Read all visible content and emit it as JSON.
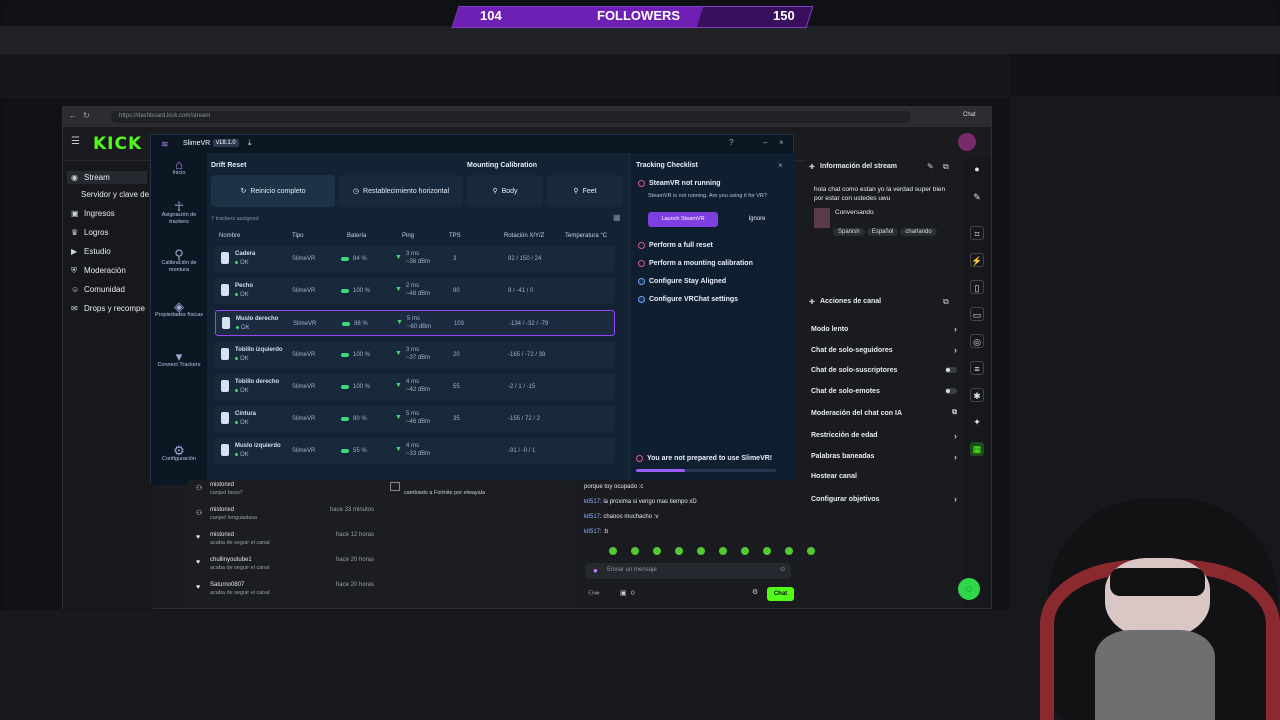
{
  "followers": {
    "current": "104",
    "label": "FOLLOWERS",
    "goal": "150",
    "progress": 0.69
  },
  "browser": {
    "url": "https://dashboard.kick.com/stream",
    "chat_ext": "Chat"
  },
  "kick": {
    "logo": "KICK"
  },
  "nav": {
    "items": [
      {
        "label": "Stream",
        "icon": "stream-icon"
      },
      {
        "label": "Servidor y clave de",
        "icon": ""
      },
      {
        "label": "Ingresos",
        "icon": "money-icon"
      },
      {
        "label": "Logros",
        "icon": "trophy-icon"
      },
      {
        "label": "Estudio",
        "icon": "studio-icon"
      },
      {
        "label": "Moderación",
        "icon": "shield-icon"
      },
      {
        "label": "Comunidad",
        "icon": "users-icon"
      },
      {
        "label": "Drops y recompe",
        "icon": "gift-icon"
      }
    ]
  },
  "slimevr": {
    "app_name": "SlimeVR",
    "version": "v18.1.0",
    "sidebar": [
      {
        "label": "Inicio",
        "icon": "home-icon"
      },
      {
        "label": "Asignación de trackers",
        "icon": "body-icon"
      },
      {
        "label": "Calibración de montura",
        "icon": "calibrate-icon"
      },
      {
        "label": "Propiedades físicas",
        "icon": "ruler-icon"
      },
      {
        "label": "Connect Trackers",
        "icon": "connect-icon"
      },
      {
        "label": "Configuración",
        "icon": "gear-icon"
      }
    ],
    "drift_reset": "Drift Reset",
    "mounting_calibration": "Mounting Calibration",
    "reset_full": "Reinicio completo",
    "reset_horizontal": "Restablecimiento horizontal",
    "body": "Body",
    "feet": "Feet",
    "assigned": "7 trackers assigned",
    "columns": [
      "Nombre",
      "Tipo",
      "Batería",
      "Ping",
      "TPS",
      "Rotación X/Y/Z",
      "Temperatura °C"
    ],
    "trackers": [
      {
        "name": "Cadera",
        "status": "OK",
        "type": "SlimeVR",
        "battery": "84 %",
        "ping": "3 ms",
        "ping2": "~36 dBm",
        "tps": "3",
        "rotation": "82 / 150 / 24"
      },
      {
        "name": "Pecho",
        "status": "OK",
        "type": "SlimeVR",
        "battery": "100 %",
        "ping": "2 ms",
        "ping2": "~48 dBm",
        "tps": "80",
        "rotation": "9 / -41 / 0"
      },
      {
        "name": "Muslo derecho",
        "status": "OK",
        "type": "SlimeVR",
        "battery": "88 %",
        "ping": "5 ms",
        "ping2": "~60 dBm",
        "tps": "103",
        "rotation": "-134 / -32 / -79"
      },
      {
        "name": "Tobillo izquierdo",
        "status": "OK",
        "type": "SlimeVR",
        "battery": "100 %",
        "ping": "3 ms",
        "ping2": "~37 dBm",
        "tps": "20",
        "rotation": "-165 / -72 / 39"
      },
      {
        "name": "Tobillo derecho",
        "status": "OK",
        "type": "SlimeVR",
        "battery": "100 %",
        "ping": "4 ms",
        "ping2": "~42 dBm",
        "tps": "55",
        "rotation": "-2 / 1 / -15"
      },
      {
        "name": "Cintura",
        "status": "OK",
        "type": "SlimeVR",
        "battery": "80 %",
        "ping": "5 ms",
        "ping2": "~46 dBm",
        "tps": "35",
        "rotation": "-155 / 72 / 2"
      },
      {
        "name": "Muslo izquierdo",
        "status": "OK",
        "type": "SlimeVR",
        "battery": "55 %",
        "ping": "4 ms",
        "ping2": "~33 dBm",
        "tps": "",
        "rotation": "-91 / -0 / 1"
      }
    ],
    "checklist": {
      "title": "Tracking Checklist",
      "steamvr_title": "SteamVR not running",
      "steamvr_desc": "SteamVR is not running. Are you using it for VR?",
      "launch": "Launch SteamVR",
      "ignore": "Ignore",
      "steps": [
        "Perform a full reset",
        "Perform a mounting calibration",
        "Configure Stay Aligned",
        "Configure VRChat settings"
      ],
      "warning": "You are not prepared to use SlimeVR!"
    }
  },
  "stream_info": {
    "title": "Información del stream",
    "text": "hola chat como estan yo la verdad super bien por estar con ustedes uwu",
    "category": "Conversando",
    "tags": [
      "Spanish",
      "Español",
      "charlando"
    ]
  },
  "channel_actions": {
    "title": "Acciones de canal",
    "items": [
      "Modo lento",
      "Chat de solo-seguidores",
      "Chat de solo-suscriptores",
      "Chat de solo-emotes",
      "Moderación del chat con IA",
      "Restricción de edad",
      "Palabras baneadas",
      "Hostear canal",
      "Configurar objetivos"
    ]
  },
  "activity": [
    {
      "user": "mistonxd",
      "sub": "canjeó beso?",
      "time": ""
    },
    {
      "user": "mistonxd",
      "sub": "canjeó lenguaslasa",
      "time": "hace 33 minutos"
    },
    {
      "user": "mistonxd",
      "sub": "acaba de seguir el canal",
      "time": "hace 12 horas"
    },
    {
      "user": "chullinyoutube1",
      "sub": "acaba de seguir el canal",
      "time": "hace 20 horas"
    },
    {
      "user": "Saturno0807",
      "sub": "acaba de seguir el canal",
      "time": "hace 20 horas"
    }
  ],
  "mid_event": {
    "text": "cambiado a Fortnite por elwayala"
  },
  "chat": {
    "lines": [
      {
        "user": "",
        "msg": "porque toy ocupado :c"
      },
      {
        "user": "kit517",
        "msg": ": la proxima si vengo mas tiempo xD"
      },
      {
        "user": "kit517",
        "msg": ": chaoos muchacho :v"
      },
      {
        "user": "kit517",
        "msg": ": :b"
      }
    ],
    "placeholder": "Enviar un mensaje",
    "viewers": "0",
    "send": "Chat"
  }
}
